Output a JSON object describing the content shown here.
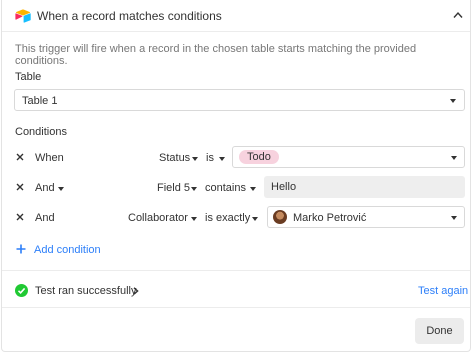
{
  "header": {
    "title": "When a record matches conditions"
  },
  "description": "This trigger will fire when a record in the chosen table starts matching the provided conditions.",
  "table_section": {
    "label": "Table",
    "selected": "Table 1"
  },
  "conditions_section": {
    "label": "Conditions",
    "rows": [
      {
        "conjunction": "When",
        "field": "Status",
        "operator": "is",
        "value": "Todo"
      },
      {
        "conjunction": "And",
        "field": "Field 5",
        "operator": "contains",
        "value": "Hello"
      },
      {
        "conjunction": "And",
        "field": "Collaborator",
        "operator": "is exactly",
        "value": "Marko Petrović"
      }
    ],
    "add_label": "Add condition"
  },
  "test": {
    "status": "Test ran successfully",
    "retry_label": "Test again"
  },
  "footer": {
    "done_label": "Done"
  },
  "colors": {
    "accent": "#2d7ff9",
    "success": "#20c933",
    "pill": "#f7d2de"
  },
  "icons": [
    "airtable-logo-icon",
    "chevron-up-icon",
    "close-icon",
    "caret-down-icon",
    "plus-icon",
    "check-circle-icon",
    "chevron-right-icon"
  ]
}
